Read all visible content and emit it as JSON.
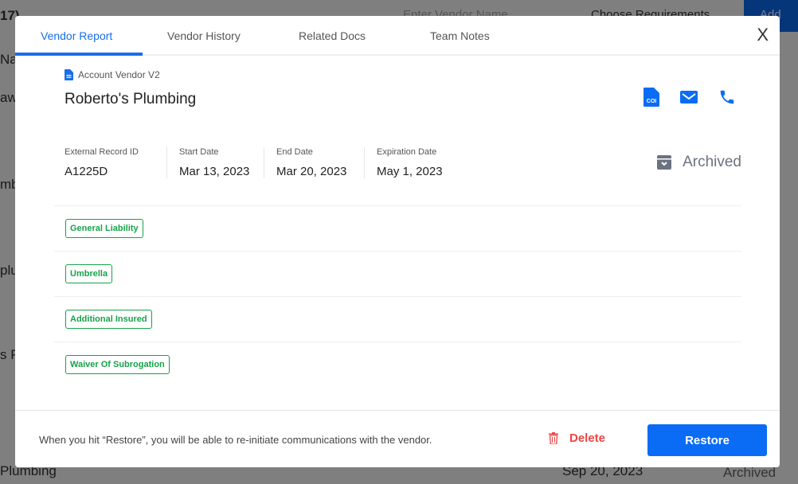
{
  "backdrop": {
    "count": "17)",
    "search_placeholder": "Enter Vendor Name",
    "requirements": "Choose Requirements",
    "add": "Add",
    "col": "Na",
    "row1": "aw",
    "row2": "mb",
    "row3": "plu",
    "row4": "s P",
    "bottom_name": "Plumbing",
    "bottom_date": "Sep 20, 2023",
    "bottom_status": "Archived"
  },
  "tabs": [
    {
      "label": "Vendor Report",
      "active": true
    },
    {
      "label": "Vendor History"
    },
    {
      "label": "Related Docs"
    },
    {
      "label": "Team Notes"
    }
  ],
  "close_label": "X",
  "vendor": {
    "account": "Account Vendor V2",
    "name": "Roberto's Plumbing",
    "icons": [
      "coi-document-icon",
      "mail-icon",
      "phone-icon"
    ]
  },
  "fields": [
    {
      "label": "External Record ID",
      "value": "A1225D"
    },
    {
      "label": "Start Date",
      "value": "Mar 13, 2023"
    },
    {
      "label": "End Date",
      "value": "Mar 20, 2023"
    },
    {
      "label": "Expiration Date",
      "value": "May 1, 2023"
    }
  ],
  "status": "Archived",
  "requirements": [
    "General Liability",
    "Umbrella",
    "Additional Insured",
    "Waiver Of Subrogation"
  ],
  "footer": {
    "note": "When you hit “Restore”, you will be able to re-initiate communications with the vendor.",
    "delete": "Delete",
    "restore": "Restore"
  },
  "colors": {
    "accent": "#0a6cf5",
    "success": "#16a34a",
    "danger": "#ef4444"
  }
}
